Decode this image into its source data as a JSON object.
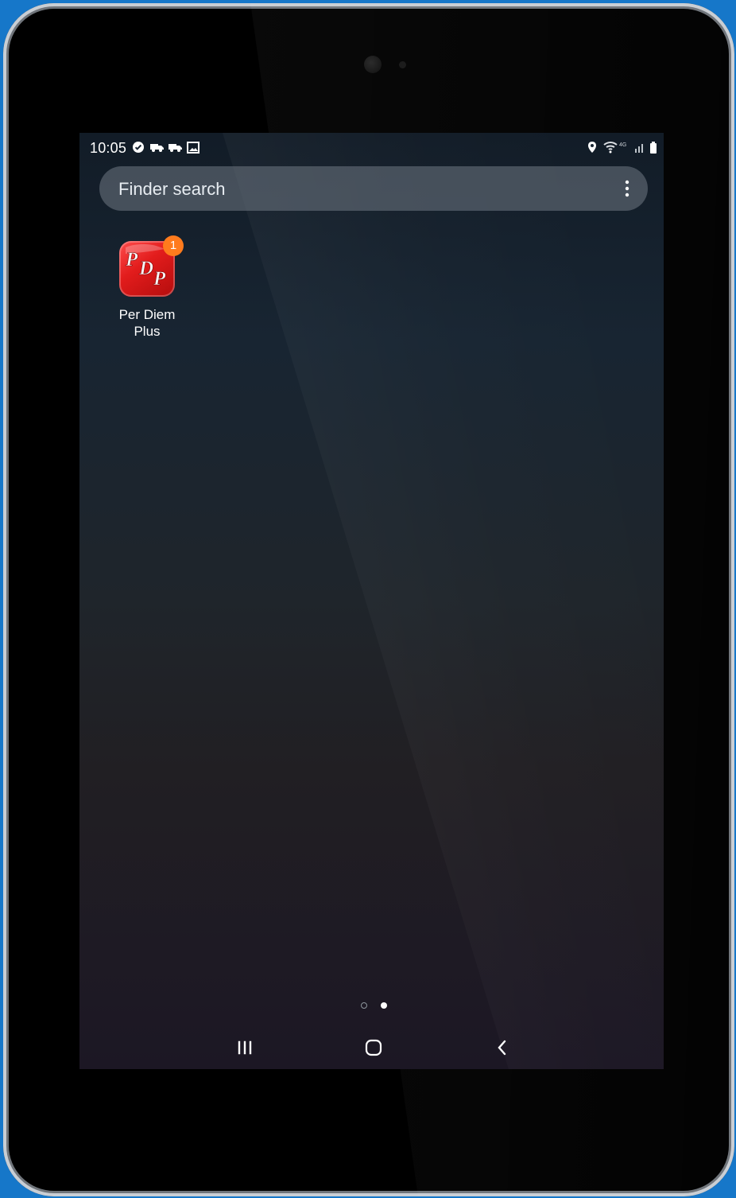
{
  "status_bar": {
    "time": "10:05",
    "left_icons": [
      "verified-icon",
      "truck-icon",
      "truck-icon",
      "image-icon"
    ],
    "right_icons": [
      "location-icon",
      "wifi-icon",
      "lte-signal-icon",
      "battery-icon"
    ]
  },
  "search": {
    "placeholder": "Finder search",
    "menu_icon": "more-vertical-icon"
  },
  "apps": [
    {
      "icon": "pdp-app-icon",
      "icon_text": "PDP",
      "label": "Per Diem\nPlus",
      "badge": "1",
      "badge_color": "#ff7b1d",
      "icon_color": "#e21c1c"
    }
  ],
  "page_indicator": {
    "pages": 2,
    "active_page": 2
  },
  "navigation": {
    "recents_icon": "recent-apps-icon",
    "home_icon": "home-icon",
    "back_icon": "back-icon"
  },
  "colors": {
    "frame_background": "#1677c9",
    "device": "#000000",
    "screen_top": "#121c27",
    "screen_bottom": "#1c1724"
  }
}
